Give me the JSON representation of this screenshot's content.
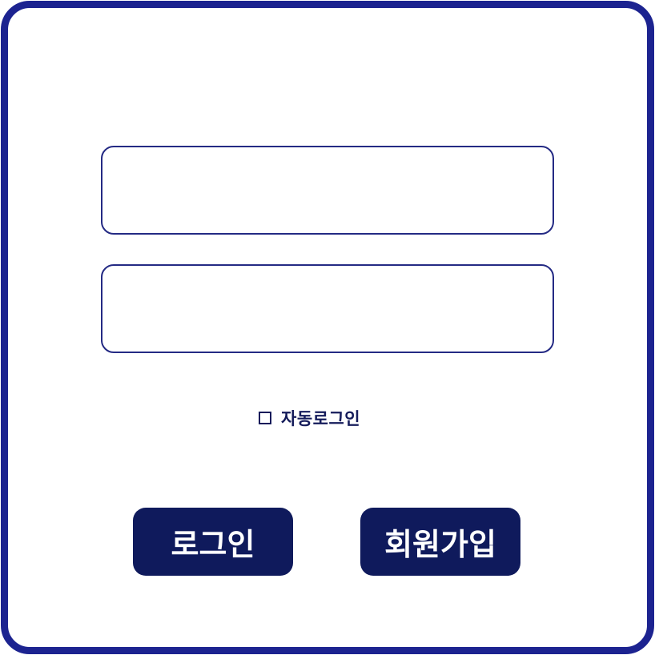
{
  "colors": {
    "frame_border": "#1c2390",
    "input_border": "#242a84",
    "button_bg": "#0f1a5c",
    "button_text": "#ffffff",
    "label_text": "#141b5a"
  },
  "login_form": {
    "id_input": {
      "value": "",
      "placeholder": ""
    },
    "password_input": {
      "value": "",
      "placeholder": ""
    },
    "auto_login": {
      "checked": false,
      "label": "자동로그인",
      "icon": "checkbox-unchecked-icon"
    },
    "login_button": "로그인",
    "signup_button": "회원가입"
  }
}
